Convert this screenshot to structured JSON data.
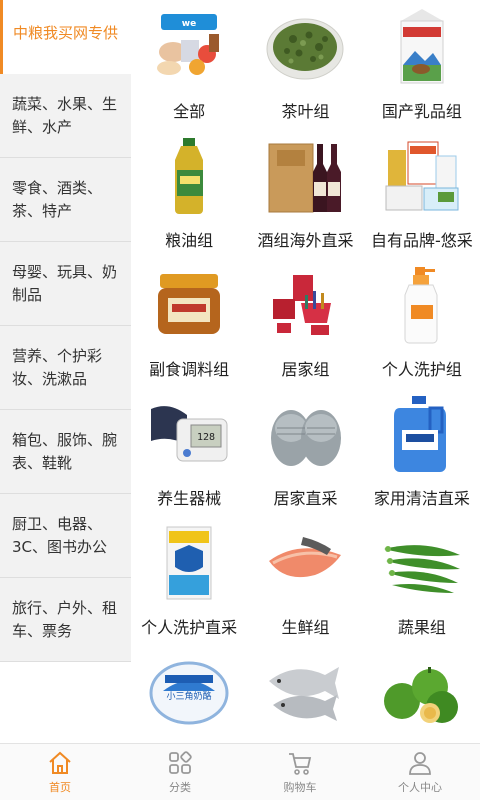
{
  "sidebar": {
    "items": [
      {
        "label": "中粮我买网专供"
      },
      {
        "label": "蔬菜、水果、生鲜、水产"
      },
      {
        "label": "零食、酒类、茶、特产"
      },
      {
        "label": "母婴、玩具、奶制品"
      },
      {
        "label": "营养、个护彩妆、洗漱品"
      },
      {
        "label": "箱包、服饰、腕表、鞋靴"
      },
      {
        "label": "厨卫、电器、3C、图书办公"
      },
      {
        "label": "旅行、户外、租车、票务"
      }
    ],
    "accent": "#f08a24"
  },
  "categories": [
    {
      "label": "全部",
      "icon": "assorted-products-icon"
    },
    {
      "label": "茶叶组",
      "icon": "tea-leaves-icon"
    },
    {
      "label": "国产乳品组",
      "icon": "milk-carton-icon"
    },
    {
      "label": "粮油组",
      "icon": "oil-bottle-icon"
    },
    {
      "label": "酒组海外直采",
      "icon": "wine-box-icon"
    },
    {
      "label": "自有品牌-悠采",
      "icon": "own-brand-products-icon"
    },
    {
      "label": "副食调料组",
      "icon": "sauce-jar-icon"
    },
    {
      "label": "居家组",
      "icon": "household-set-icon"
    },
    {
      "label": "个人洗护组",
      "icon": "shampoo-bottle-icon"
    },
    {
      "label": "养生器械",
      "icon": "blood-pressure-monitor-icon"
    },
    {
      "label": "居家直采",
      "icon": "slippers-icon"
    },
    {
      "label": "家用清洁直采",
      "icon": "detergent-bottle-icon"
    },
    {
      "label": "个人洗护直采",
      "icon": "soap-box-icon"
    },
    {
      "label": "生鲜组",
      "icon": "salmon-icon"
    },
    {
      "label": "蔬果组",
      "icon": "okra-icon"
    },
    {
      "label": "",
      "icon": "dairy-tub-icon"
    },
    {
      "label": "",
      "icon": "fish-icon"
    },
    {
      "label": "",
      "icon": "lime-icon"
    }
  ],
  "tabbar": {
    "tabs": [
      {
        "label": "首页",
        "icon": "home-icon"
      },
      {
        "label": "分类",
        "icon": "category-icon"
      },
      {
        "label": "购物车",
        "icon": "cart-icon"
      },
      {
        "label": "个人中心",
        "icon": "user-icon"
      }
    ]
  }
}
